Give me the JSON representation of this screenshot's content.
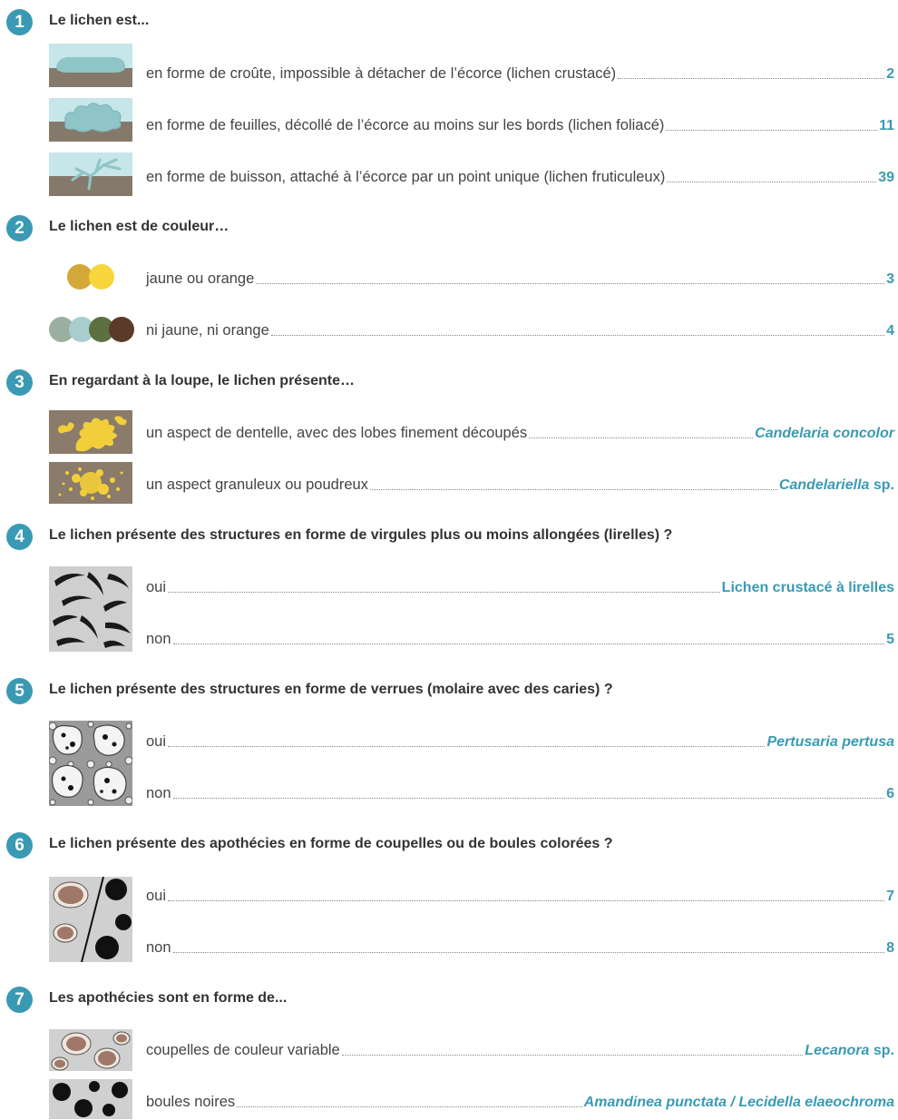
{
  "steps": [
    {
      "number": "1",
      "question": "Le lichen est...",
      "choices": [
        {
          "text": "en forme de croûte, impossible à détacher de l’écorce (lichen crustacé)",
          "result_italic": "",
          "result": "2",
          "icon": "crustose-lichen-icon"
        },
        {
          "text": "en forme de feuilles, décollé de l’écorce au moins sur les bords (lichen foliacé)",
          "result_italic": "",
          "result": "11",
          "icon": "foliose-lichen-icon"
        },
        {
          "text": "en forme de buisson, attaché à l’écorce par un point unique (lichen fruticuleux)",
          "result_italic": "",
          "result": "39",
          "icon": "fruticose-lichen-icon"
        }
      ]
    },
    {
      "number": "2",
      "question": "Le lichen est de couleur…",
      "choices": [
        {
          "text": "jaune ou orange",
          "result_italic": "",
          "result": "3",
          "icon": "yellow-orange-swatch-icon"
        },
        {
          "text": "ni jaune, ni orange",
          "result_italic": "",
          "result": "4",
          "icon": "green-grey-brown-swatch-icon"
        }
      ]
    },
    {
      "number": "3",
      "question": "En regardant à la loupe, le lichen présente…",
      "choices": [
        {
          "text": "un aspect de dentelle, avec des lobes finement découpés",
          "result_italic": "Candelaria concolor",
          "result": "",
          "icon": "lace-lobes-icon"
        },
        {
          "text": "un aspect granuleux ou poudreux",
          "result_italic": "Candelariella",
          "result": " sp.",
          "icon": "granular-powder-icon"
        }
      ]
    },
    {
      "number": "4",
      "question": "Le lichen présente des structures en forme de virgules plus ou moins allongées (lirelles) ?",
      "choices": [
        {
          "text": "oui",
          "result_italic": "",
          "result": "Lichen crustacé à lirelles",
          "icon": "lirellae-icon"
        },
        {
          "text": "non",
          "result_italic": "",
          "result": "5",
          "icon": ""
        }
      ]
    },
    {
      "number": "5",
      "question": "Le lichen présente des structures en forme de verrues (molaire avec des caries) ?",
      "choices": [
        {
          "text": "oui",
          "result_italic": "Pertusaria pertusa",
          "result": "",
          "icon": "warts-icon"
        },
        {
          "text": "non",
          "result_italic": "",
          "result": "6",
          "icon": ""
        }
      ]
    },
    {
      "number": "6",
      "question": "Le lichen présente des apothécies en forme de coupelles ou de boules colorées ?",
      "choices": [
        {
          "text": "oui",
          "result_italic": "",
          "result": "7",
          "icon": "apothecia-icon"
        },
        {
          "text": "non",
          "result_italic": "",
          "result": "8",
          "icon": ""
        }
      ]
    },
    {
      "number": "7",
      "question": "Les apothécies sont en forme de...",
      "choices": [
        {
          "text": "coupelles de couleur variable",
          "result_italic": "Lecanora",
          "result": " sp.",
          "icon": "cups-icon"
        },
        {
          "text": "boules noires",
          "result_italic": "Amandinea punctata / Lecidella elaeochroma",
          "result": "",
          "icon": "black-balls-icon"
        }
      ]
    }
  ],
  "colors": {
    "accent": "#3a9ab3",
    "bark": "#85796b",
    "lichen_teal": "#8fc5c6",
    "yellow": "#f2cf3a"
  }
}
